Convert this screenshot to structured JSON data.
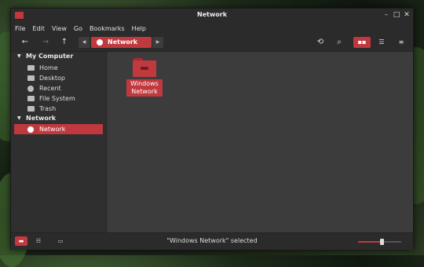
{
  "window": {
    "title": "Network"
  },
  "menubar": {
    "items": [
      "File",
      "Edit",
      "View",
      "Go",
      "Bookmarks",
      "Help"
    ]
  },
  "toolbar": {
    "location": "Network"
  },
  "sidebar": {
    "sections": [
      {
        "title": "My Computer",
        "items": [
          "Home",
          "Desktop",
          "Recent",
          "File System",
          "Trash"
        ]
      },
      {
        "title": "Network",
        "items": [
          "Network"
        ]
      }
    ]
  },
  "files": [
    {
      "name": "Windows Network"
    }
  ],
  "statusbar": {
    "text": "\"Windows Network\" selected",
    "zoom_fraction": 0.55
  },
  "colors": {
    "accent": "#c0393f",
    "background": "#2f2f2f",
    "content": "#3c3c3c"
  }
}
